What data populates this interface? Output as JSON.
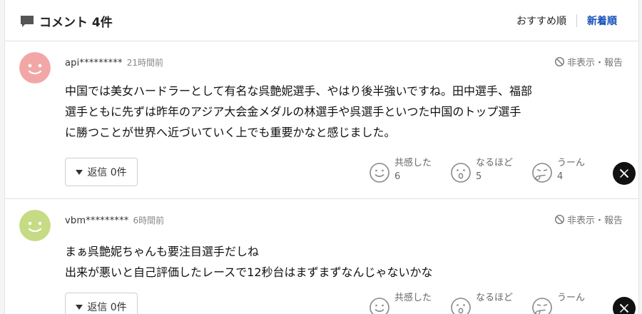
{
  "header": {
    "title": "コメント 4件",
    "sort_recommended": "おすすめ順",
    "sort_newest": "新着順"
  },
  "comments": [
    {
      "user": "api*********",
      "time": "21時間前",
      "hide_report": "非表示・報告",
      "avatar_color": "#f2a7a7",
      "body": "中国では美女ハードラーとして有名な呉艶妮選手、やはり後半強いですね。田中選手、福部\n選手ともに先ずは昨年のアジア大会金メダルの林選手や呉選手といつた中国のトップ選手\nに勝つことが世界へ近づいていく上でも重要かなと感じました。",
      "reply_label": "返信 0件",
      "reactions": [
        {
          "label": "共感した",
          "count": "6"
        },
        {
          "label": "なるほど",
          "count": "5"
        },
        {
          "label": "うーん",
          "count": "4"
        }
      ]
    },
    {
      "user": "vbm*********",
      "time": "6時間前",
      "hide_report": "非表示・報告",
      "avatar_color": "#c5db84",
      "body": "まぁ呉艶妮ちゃんも要注目選手だしね\n出来が悪いと自己評価したレースで12秒台はまずまずなんじゃないかな",
      "reply_label": "返信 0件",
      "reactions": [
        {
          "label": "共感した",
          "count": ""
        },
        {
          "label": "なるほど",
          "count": ""
        },
        {
          "label": "うーん",
          "count": ""
        }
      ]
    }
  ],
  "icons": {
    "comment": "comment-bubble-icon",
    "hide": "prohibit-icon",
    "react1": "smile-face-icon",
    "react2": "surprised-face-icon",
    "react3": "thinking-face-icon",
    "share": "x-logo-icon"
  },
  "colors": {
    "accent": "#1550b8",
    "avatar1": "#f2a7a7",
    "avatar2": "#c5db84"
  }
}
